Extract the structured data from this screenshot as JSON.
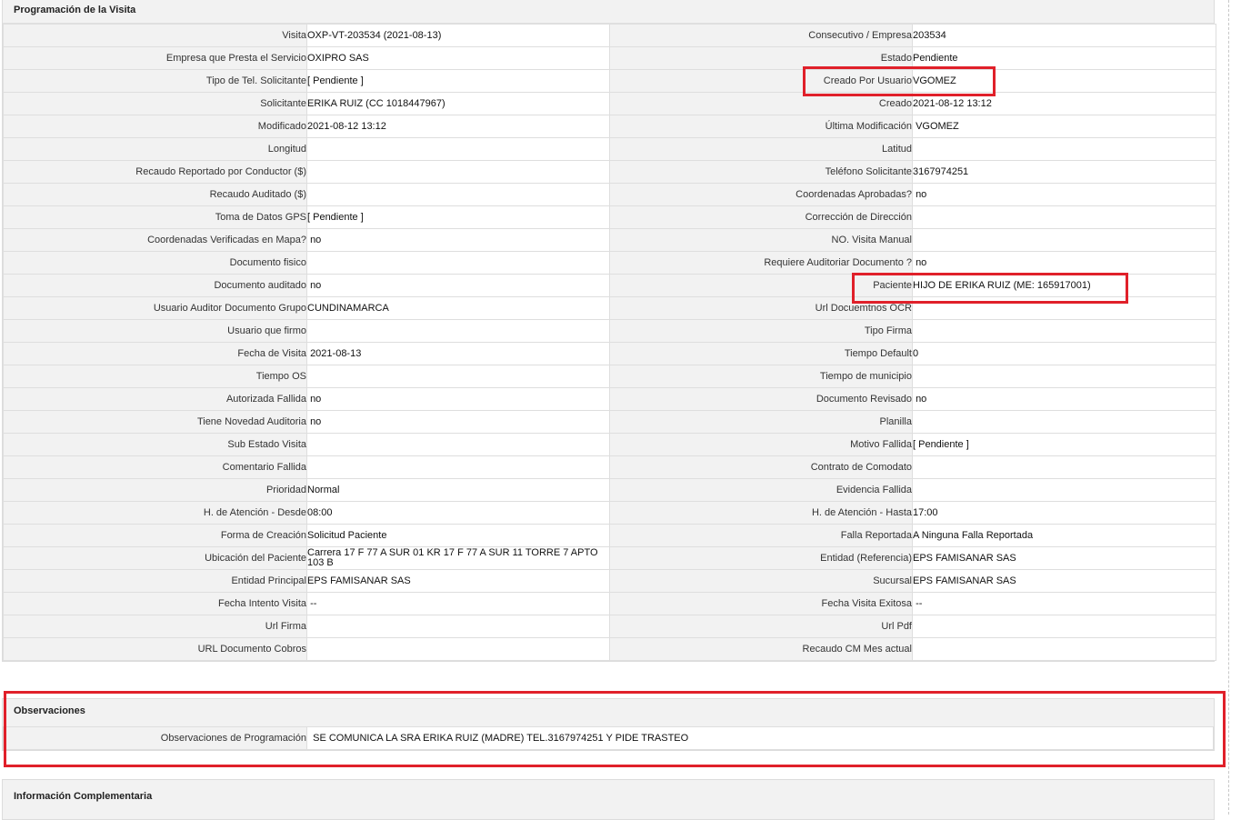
{
  "section_programacion": {
    "title": "Programación de la Visita",
    "rows": [
      {
        "l1": "Visita",
        "v1": "OXP-VT-203534 (2021-08-13)",
        "l2": "Consecutivo / Empresa",
        "v2": "203534"
      },
      {
        "l1": "Empresa que Presta el Servicio",
        "v1": "OXIPRO SAS",
        "l2": "Estado",
        "v2": "Pendiente"
      },
      {
        "l1": "Tipo de Tel. Solicitante",
        "v1": "[ Pendiente ]",
        "l2": "Creado Por Usuario",
        "v2": "VGOMEZ"
      },
      {
        "l1": "Solicitante",
        "v1": "ERIKA RUIZ (CC 1018447967)",
        "l2": "Creado",
        "v2": "2021-08-12 13:12"
      },
      {
        "l1": "Modificado",
        "v1": "2021-08-12 13:12",
        "l2": "Última Modificación",
        "v2": " VGOMEZ"
      },
      {
        "l1": "Longitud",
        "v1": "",
        "l2": "Latitud",
        "v2": ""
      },
      {
        "l1": "Recaudo Reportado por Conductor ($)",
        "v1": "",
        "l2": "Teléfono Solicitante",
        "v2": "3167974251"
      },
      {
        "l1": "Recaudo Auditado ($)",
        "v1": "",
        "l2": "Coordenadas Aprobadas?",
        "v2": " no"
      },
      {
        "l1": "Toma de Datos GPS",
        "v1": "[ Pendiente ]",
        "l2": "Corrección de Dirección",
        "v2": ""
      },
      {
        "l1": "Coordenadas Verificadas en Mapa?",
        "v1": " no",
        "l2": "NO. Visita Manual",
        "v2": ""
      },
      {
        "l1": "Documento fisico",
        "v1": "",
        "l2": "Requiere Auditoriar Documento ?",
        "v2": " no"
      },
      {
        "l1": "Documento auditado",
        "v1": " no",
        "l2": "Paciente",
        "v2": "HIJO DE ERIKA RUIZ (ME: 165917001)"
      },
      {
        "l1": "Usuario Auditor Documento Grupo",
        "v1": "CUNDINAMARCA",
        "l2": "Url Docuemtnos OCR",
        "v2": ""
      },
      {
        "l1": "Usuario que firmo",
        "v1": "",
        "l2": "Tipo Firma",
        "v2": ""
      },
      {
        "l1": "Fecha de Visita",
        "v1": " 2021-08-13",
        "l2": "Tiempo Default",
        "v2": "0"
      },
      {
        "l1": "Tiempo OS",
        "v1": "",
        "l2": "Tiempo de municipio",
        "v2": ""
      },
      {
        "l1": "Autorizada Fallida",
        "v1": " no",
        "l2": "Documento Revisado",
        "v2": " no"
      },
      {
        "l1": "Tiene Novedad Auditoria",
        "v1": " no",
        "l2": "Planilla",
        "v2": ""
      },
      {
        "l1": "Sub Estado Visita",
        "v1": "",
        "l2": "Motivo Fallida",
        "v2": "[ Pendiente ]"
      },
      {
        "l1": "Comentario Fallida",
        "v1": "",
        "l2": "Contrato de Comodato",
        "v2": ""
      },
      {
        "l1": "Prioridad",
        "v1": "Normal",
        "l2": "Evidencia Fallida",
        "v2": ""
      },
      {
        "l1": "H. de Atención - Desde",
        "v1": "08:00",
        "l2": "H. de Atención - Hasta",
        "v2": "17:00"
      },
      {
        "l1": "Forma de Creación",
        "v1": "Solicitud Paciente",
        "l2": "Falla Reportada",
        "v2": "A Ninguna Falla Reportada"
      },
      {
        "l1": "Ubicación del Paciente",
        "v1": "Carrera 17 F 77 A SUR 01 KR 17 F 77 A SUR 11 TORRE 7 APTO 103 B",
        "l2": "Entidad (Referencia)",
        "v2": "EPS FAMISANAR SAS"
      },
      {
        "l1": "Entidad Principal",
        "v1": "EPS FAMISANAR SAS",
        "l2": "Sucursal",
        "v2": "EPS FAMISANAR SAS"
      },
      {
        "l1": "Fecha Intento Visita",
        "v1": " --",
        "l2": "Fecha Visita Exitosa",
        "v2": " --"
      },
      {
        "l1": "Url Firma",
        "v1": "",
        "l2": "Url Pdf",
        "v2": ""
      },
      {
        "l1": "URL Documento Cobros",
        "v1": "",
        "l2": "Recaudo CM Mes actual",
        "v2": ""
      }
    ]
  },
  "section_observaciones": {
    "title": "Observaciones",
    "label": "Observaciones de Programación",
    "value": "  SE COMUNICA LA SRA ERIKA RUIZ (MADRE) TEL.3167974251 Y PIDE TRASTEO"
  },
  "section_complementaria": {
    "title": "Información Complementaria"
  },
  "colors": {
    "highlight": "#e0202a",
    "label_bg": "#f2f2f2",
    "value_bg": "#ffffff",
    "border": "#dedede"
  }
}
